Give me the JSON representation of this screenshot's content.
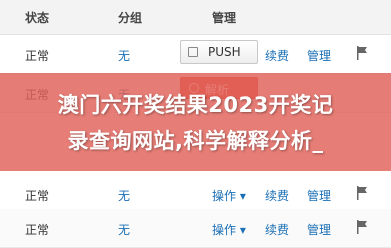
{
  "header": {
    "col_status": "状态",
    "col_group": "分组",
    "col_manage": "管理"
  },
  "rows": [
    {
      "status": "正常",
      "group": "无",
      "button": "PUSH",
      "continue": "续费",
      "manage": "管理"
    },
    {
      "status": "正常",
      "group": "无",
      "button": "解析"
    },
    {
      "status": "正常",
      "group": "无",
      "op": "操作 ▾",
      "continue": "续费",
      "manage": "管理"
    },
    {
      "status": "正常",
      "group": "无",
      "op": "操作 ▾",
      "continue": "续费",
      "manage": "管理"
    }
  ],
  "overlay": {
    "line1": "澳门六开奖结果2023开奖记",
    "line2": "录查询网站,科学解释分析_"
  },
  "colors": {
    "overlay": "#e06058",
    "link": "#1a6fb5",
    "parse_button": "#e85b4a"
  },
  "icons": {
    "flag": "flag-icon",
    "push": "push-icon"
  }
}
